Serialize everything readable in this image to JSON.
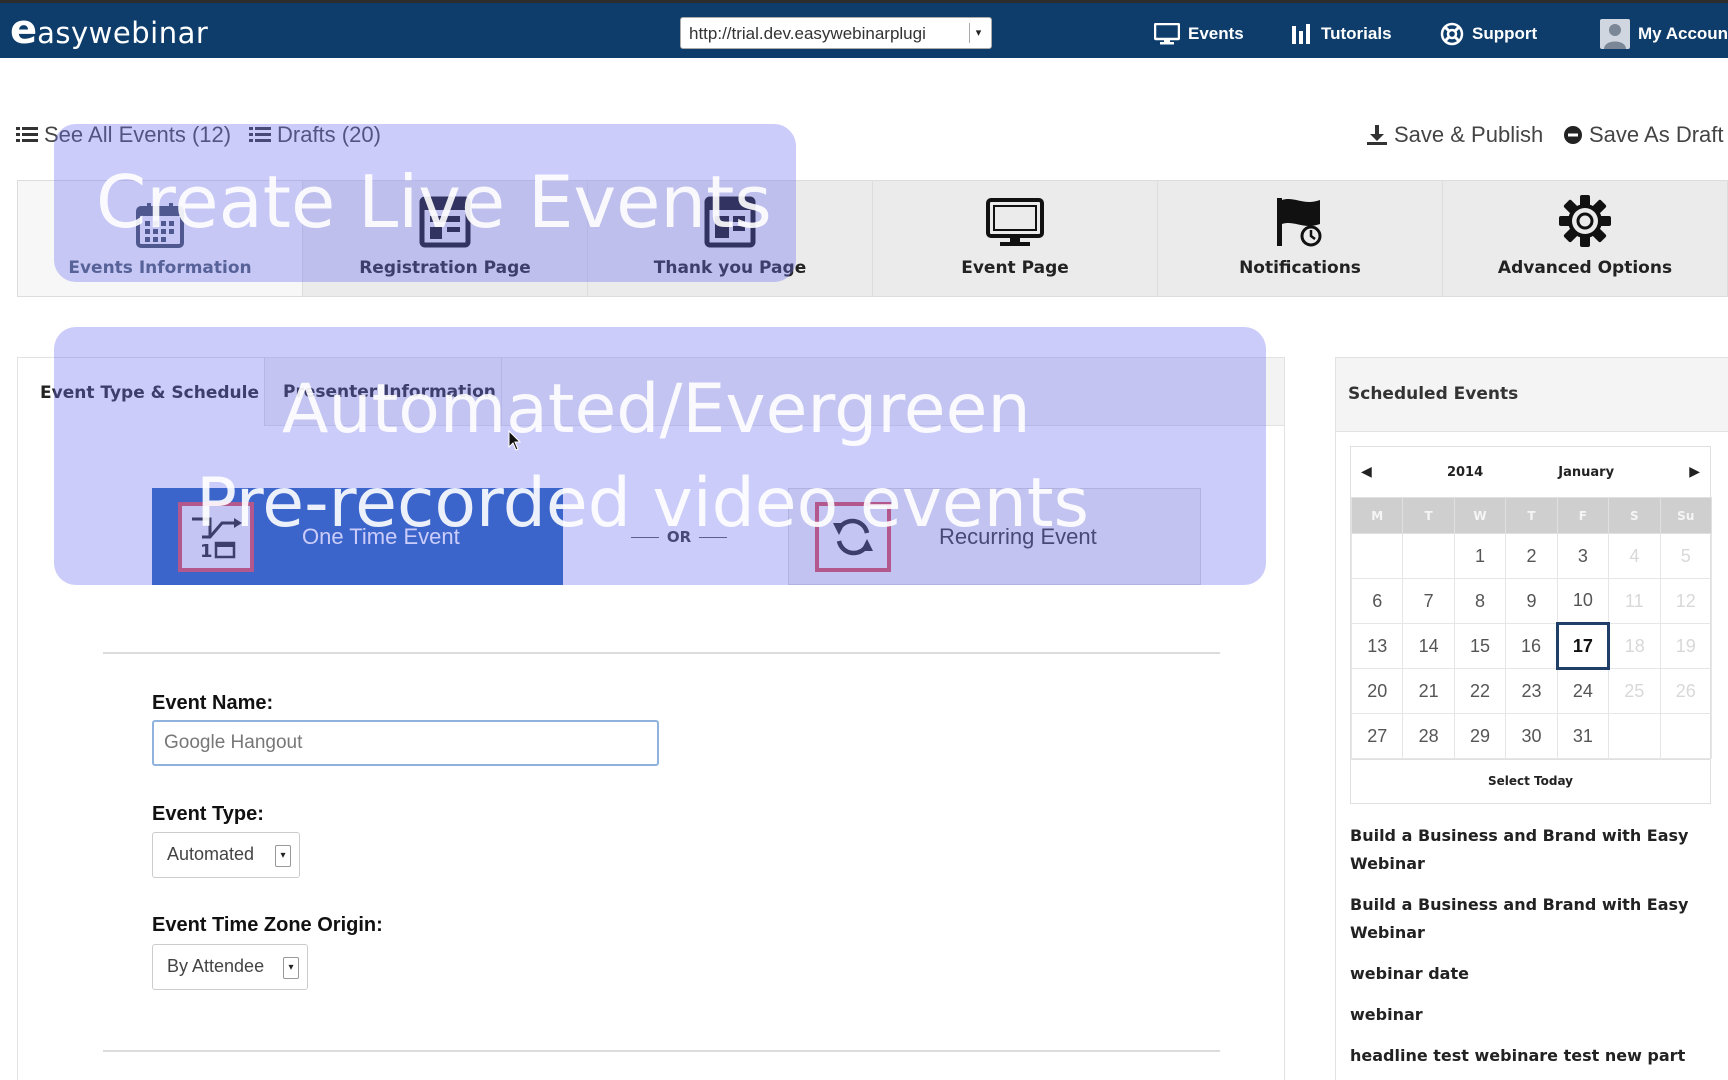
{
  "header": {
    "logo_e": "e",
    "logo_text": "asywebinar",
    "site_url": "http://trial.dev.easywebinarplugi",
    "nav": [
      {
        "label": "Events",
        "icon": "monitor-icon"
      },
      {
        "label": "Tutorials",
        "icon": "bars-icon"
      },
      {
        "label": "Support",
        "icon": "lifebuoy-icon"
      },
      {
        "label": "My Accoun",
        "icon": "user-icon"
      }
    ]
  },
  "actions": {
    "see_all": "See All Events (12)",
    "drafts": "Drafts (20)",
    "save_publish": "Save & Publish",
    "save_draft": "Save As Draft"
  },
  "steps": [
    {
      "label": "Events Information",
      "icon": "calendar-icon"
    },
    {
      "label": "Registration Page",
      "icon": "registration-icon"
    },
    {
      "label": "Thank you Page",
      "icon": "thankyou-page-icon"
    },
    {
      "label": "Event Page",
      "icon": "monitor-icon"
    },
    {
      "label": "Notifications",
      "icon": "flag-icon"
    },
    {
      "label": "Advanced Options",
      "icon": "gear-icon"
    }
  ],
  "subtabs": {
    "schedule": "Event Type & Schedule",
    "presenter": "Presenter Information"
  },
  "event_choice": {
    "one_time": "One Time Event",
    "or": "OR",
    "recurring": "Recurring Event"
  },
  "form": {
    "name_label": "Event Name:",
    "name_value": "Google Hangout",
    "type_label": "Event Type:",
    "type_value": "Automated",
    "tz_label": "Event Time Zone Origin:",
    "tz_value": "By Attendee"
  },
  "sidebar": {
    "title": "Scheduled Events",
    "calendar": {
      "year": "2014",
      "month": "January",
      "weekdays": [
        "M",
        "T",
        "W",
        "T",
        "F",
        "S",
        "Su"
      ],
      "weeks": [
        [
          "",
          "",
          "1",
          "2",
          "3",
          "4",
          "5"
        ],
        [
          "6",
          "7",
          "8",
          "9",
          "10",
          "11",
          "12"
        ],
        [
          "13",
          "14",
          "15",
          "16",
          "17",
          "18",
          "19"
        ],
        [
          "20",
          "21",
          "22",
          "23",
          "24",
          "25",
          "26"
        ],
        [
          "27",
          "28",
          "29",
          "30",
          "31",
          "",
          ""
        ]
      ],
      "today": "17",
      "select_today": "Select Today"
    },
    "events": [
      "Build a Business and Brand with Easy Webinar",
      "Build a Business and Brand with Easy Webinar",
      "webinar date",
      "webinar",
      "headline test webinare test new part"
    ]
  },
  "overlays": {
    "title": "Create Live Events",
    "line1": "Automated/Evergreen",
    "line2": "Pre-recorded video events"
  },
  "colors": {
    "topbar": "#0e3d6b",
    "primary_button": "#1f5fb8",
    "overlay": "#6e73ee",
    "icon_border": "#d84a55"
  }
}
